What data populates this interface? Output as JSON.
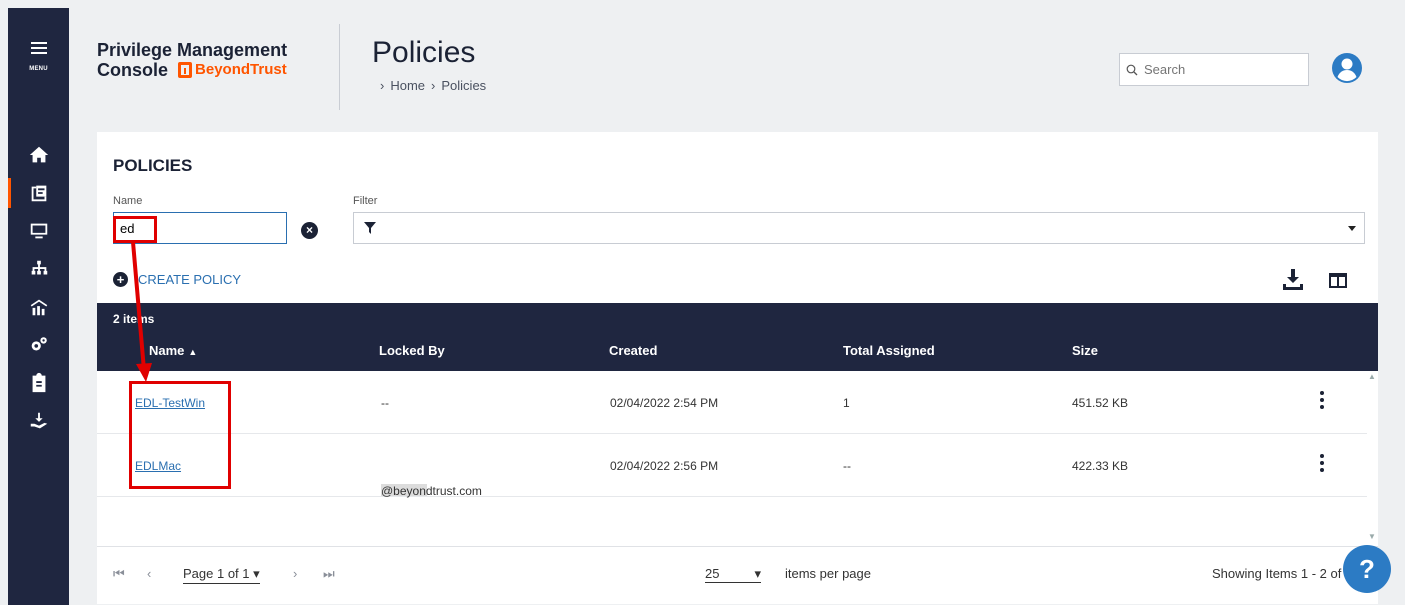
{
  "rail": {
    "menu_label": "MENU",
    "items": [
      {
        "icon": "home-icon",
        "active": false
      },
      {
        "icon": "policies-icon",
        "active": true
      },
      {
        "icon": "computer-icon",
        "active": false
      },
      {
        "icon": "groups-icon",
        "active": false
      },
      {
        "icon": "analytics-icon",
        "active": false
      },
      {
        "icon": "settings-icon",
        "active": false
      },
      {
        "icon": "clipboard-icon",
        "active": false
      },
      {
        "icon": "deploy-icon",
        "active": false
      }
    ]
  },
  "header": {
    "brand_line1": "Privilege Management",
    "brand_line2": "Console",
    "logo_text": "BeyondTrust",
    "title": "Policies",
    "crumb_home": "Home",
    "crumb_current": "Policies",
    "search_placeholder": "Search"
  },
  "card": {
    "title": "POLICIES",
    "name_label": "Name",
    "name_value": "ed",
    "filter_label": "Filter",
    "create_label": "CREATE POLICY"
  },
  "table": {
    "count": "2 items",
    "columns": [
      "Name",
      "Locked By",
      "Created",
      "Total Assigned",
      "Size"
    ],
    "rows": [
      {
        "name": "EDL-TestWin",
        "locked_by": "--",
        "created": "02/04/2022 2:54 PM",
        "total_assigned": "1",
        "size": "451.52 KB"
      },
      {
        "name": "EDLMac",
        "locked_by": "@beyondtrust.com",
        "created": "02/04/2022 2:56 PM",
        "total_assigned": "--",
        "size": "422.33 KB"
      }
    ]
  },
  "pager": {
    "page": "Page 1 of 1",
    "per_page": "25",
    "per_page_label": "items per page",
    "showing": "Showing Items 1 - 2 of 2"
  },
  "colors": {
    "rail": "#1f2640",
    "accent": "#ff5500",
    "link": "#2a6fb0",
    "annotation": "#e00000"
  }
}
